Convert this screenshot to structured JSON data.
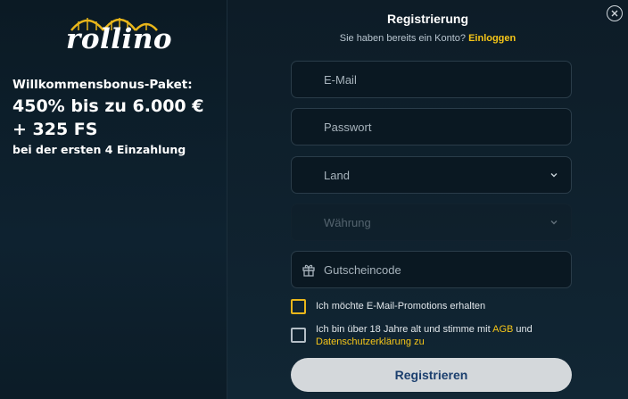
{
  "brand": {
    "logo_text": "rollino",
    "accent": "#f5c518"
  },
  "bonus": {
    "title": "Willkommensbonus-Paket:",
    "line1": "450% bis zu 6.000 €",
    "line2": "+ 325 FS",
    "line3": "bei der ersten 4 Einzahlung"
  },
  "form": {
    "title": "Registrierung",
    "has_account": "Sie haben bereits ein Konto?",
    "login_link": "Einloggen",
    "email_placeholder": "E-Mail",
    "password_placeholder": "Passwort",
    "country_label": "Land",
    "currency_label": "Währung",
    "coupon_placeholder": "Gutscheincode",
    "promo_label": "Ich möchte E-Mail-Promotions erhalten",
    "terms_part1": "Ich bin über 18 Jahre alt und stimme mit ",
    "terms_agb": "AGB",
    "terms_part2": " und",
    "terms_privacy": "Datenschutzerklärung",
    "terms_part3": " zu",
    "register_button": "Registrieren"
  },
  "icons": {
    "close": "close-icon",
    "chevron": "chevron-down-icon",
    "gift": "gift-icon"
  }
}
